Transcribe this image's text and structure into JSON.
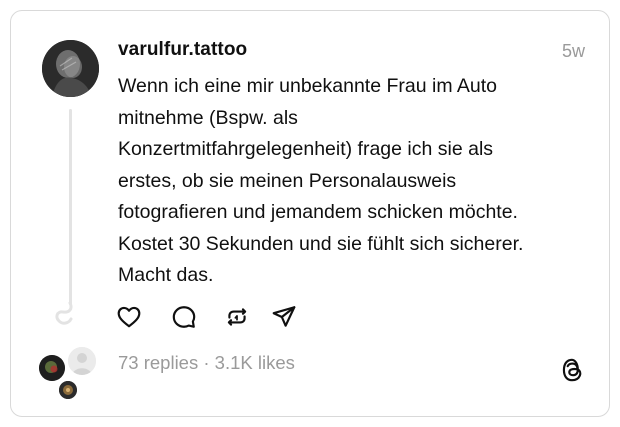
{
  "post": {
    "username": "varulfur.tattoo",
    "timestamp": "5w",
    "body_lines": [
      "Wenn ich eine mir unbekannte Frau im Auto",
      "mitnehme (Bspw. als",
      "Konzertmitfahrgelegenheit) frage ich sie als",
      "erstes, ob sie meinen Personalausweis",
      "fotografieren und jemandem schicken möchte.",
      "Kostet 30 Sekunden und sie fühlt sich sicherer.",
      "Macht das."
    ]
  },
  "actions": {
    "like_icon": "heart-icon",
    "reply_icon": "speech-bubble-icon",
    "repost_icon": "repost-icon",
    "share_icon": "send-icon"
  },
  "footer": {
    "replies": "73 replies",
    "separator": "·",
    "likes": "3.1K likes",
    "logo": "threads-logo-icon"
  },
  "colors": {
    "text": "#101010",
    "muted": "#9a9a9a",
    "border": "#d9d9d9"
  }
}
